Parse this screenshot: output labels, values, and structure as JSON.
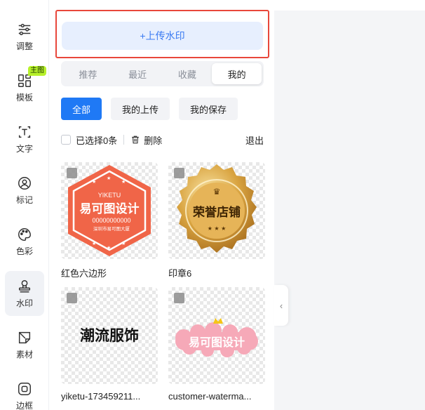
{
  "rail": {
    "items": [
      {
        "label": "调整",
        "icon": "sliders-icon"
      },
      {
        "label": "模板",
        "icon": "template-grid-icon",
        "badge": "主图"
      },
      {
        "label": "文字",
        "icon": "text-icon"
      },
      {
        "label": "标记",
        "icon": "marker-icon"
      },
      {
        "label": "色彩",
        "icon": "palette-icon"
      },
      {
        "label": "水印",
        "icon": "stamp-icon",
        "active": true
      },
      {
        "label": "素材",
        "icon": "sticker-icon"
      },
      {
        "label": "边框",
        "icon": "frame-icon"
      }
    ]
  },
  "panel": {
    "upload_label": "+上传水印",
    "tabs": [
      "推荐",
      "最近",
      "收藏",
      "我的"
    ],
    "active_tab": "我的",
    "filters": [
      "全部",
      "我的上传",
      "我的保存"
    ],
    "active_filter": "全部",
    "selected_text": "已选择0条",
    "delete_label": "删除",
    "exit_label": "退出",
    "watermarks": [
      {
        "name": "红色六边形",
        "brand": "YIKETU",
        "title": "易可图设计",
        "phone": "00000000000",
        "address": "深圳市易可图大厦",
        "color": "#f06548"
      },
      {
        "name": "印章6",
        "title": "荣誉店铺",
        "color": "#d9a441"
      },
      {
        "name": "yiketu-173459211...",
        "title": "潮流服饰"
      },
      {
        "name": "customer-waterma...",
        "title": "易可图设计",
        "color": "#f6a9b8"
      }
    ]
  },
  "collapse_icon": "chevron-left-icon"
}
